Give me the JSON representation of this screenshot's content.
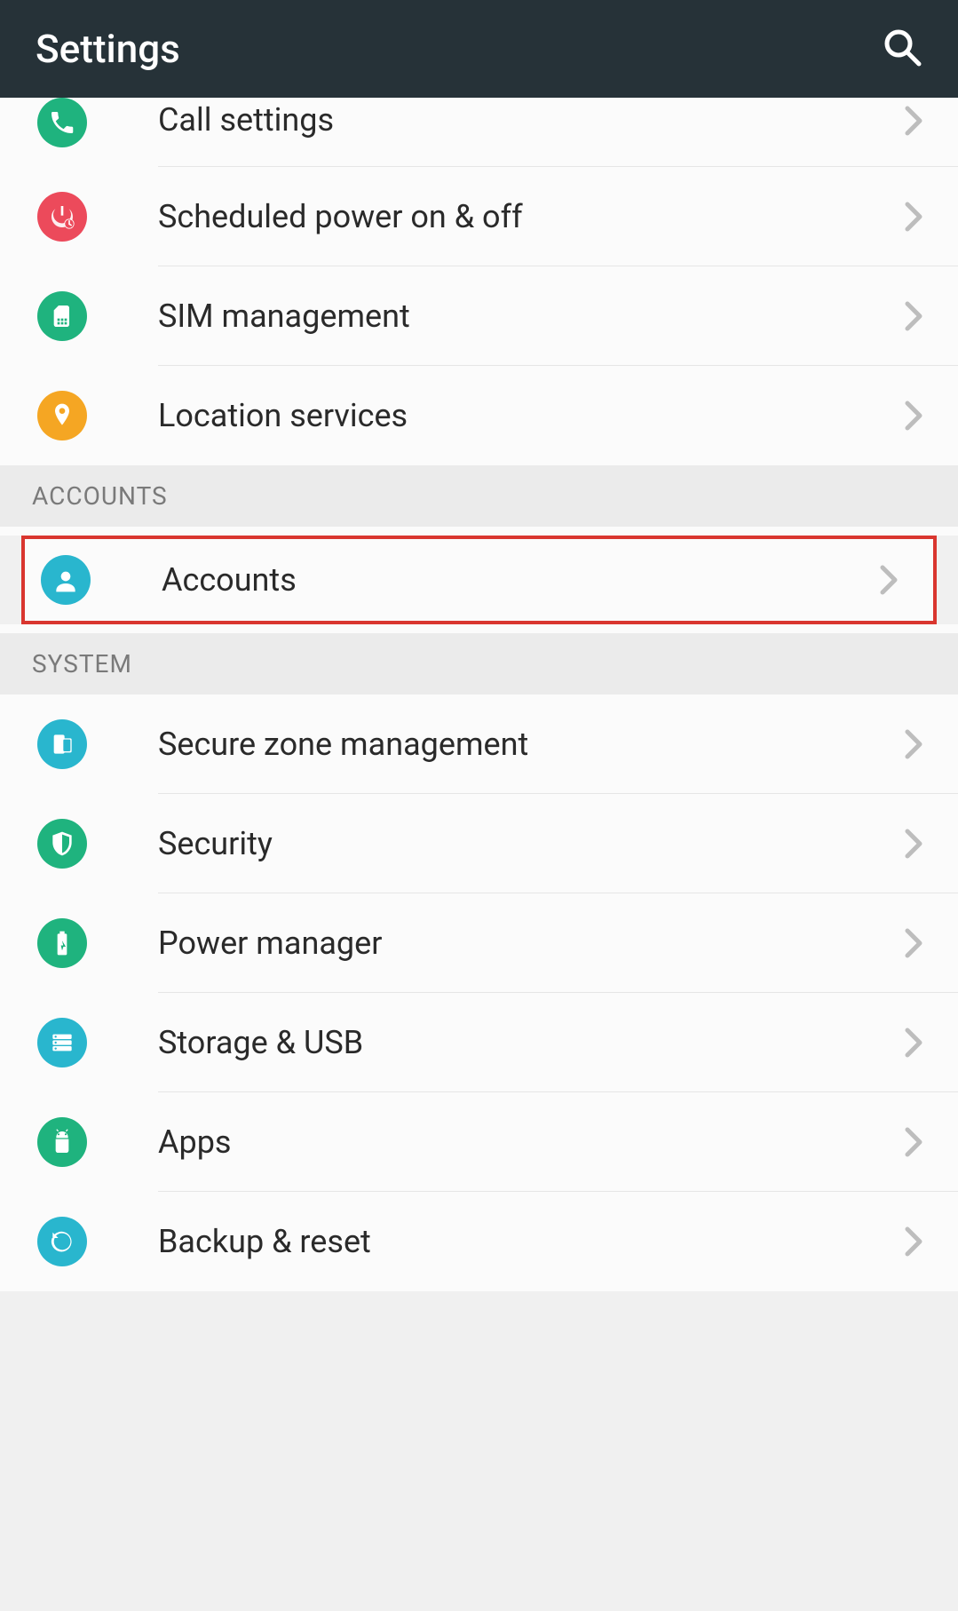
{
  "header": {
    "title": "Settings"
  },
  "sections": {
    "top": [
      {
        "label": "Call settings"
      },
      {
        "label": "Scheduled power on & off"
      },
      {
        "label": "SIM management"
      },
      {
        "label": "Location services"
      }
    ],
    "accounts_header": "ACCOUNTS",
    "accounts_item": {
      "label": "Accounts"
    },
    "system_header": "SYSTEM",
    "system": [
      {
        "label": "Secure zone management"
      },
      {
        "label": "Security"
      },
      {
        "label": "Power manager"
      },
      {
        "label": "Storage & USB"
      },
      {
        "label": "Apps"
      },
      {
        "label": "Backup & reset"
      }
    ]
  }
}
